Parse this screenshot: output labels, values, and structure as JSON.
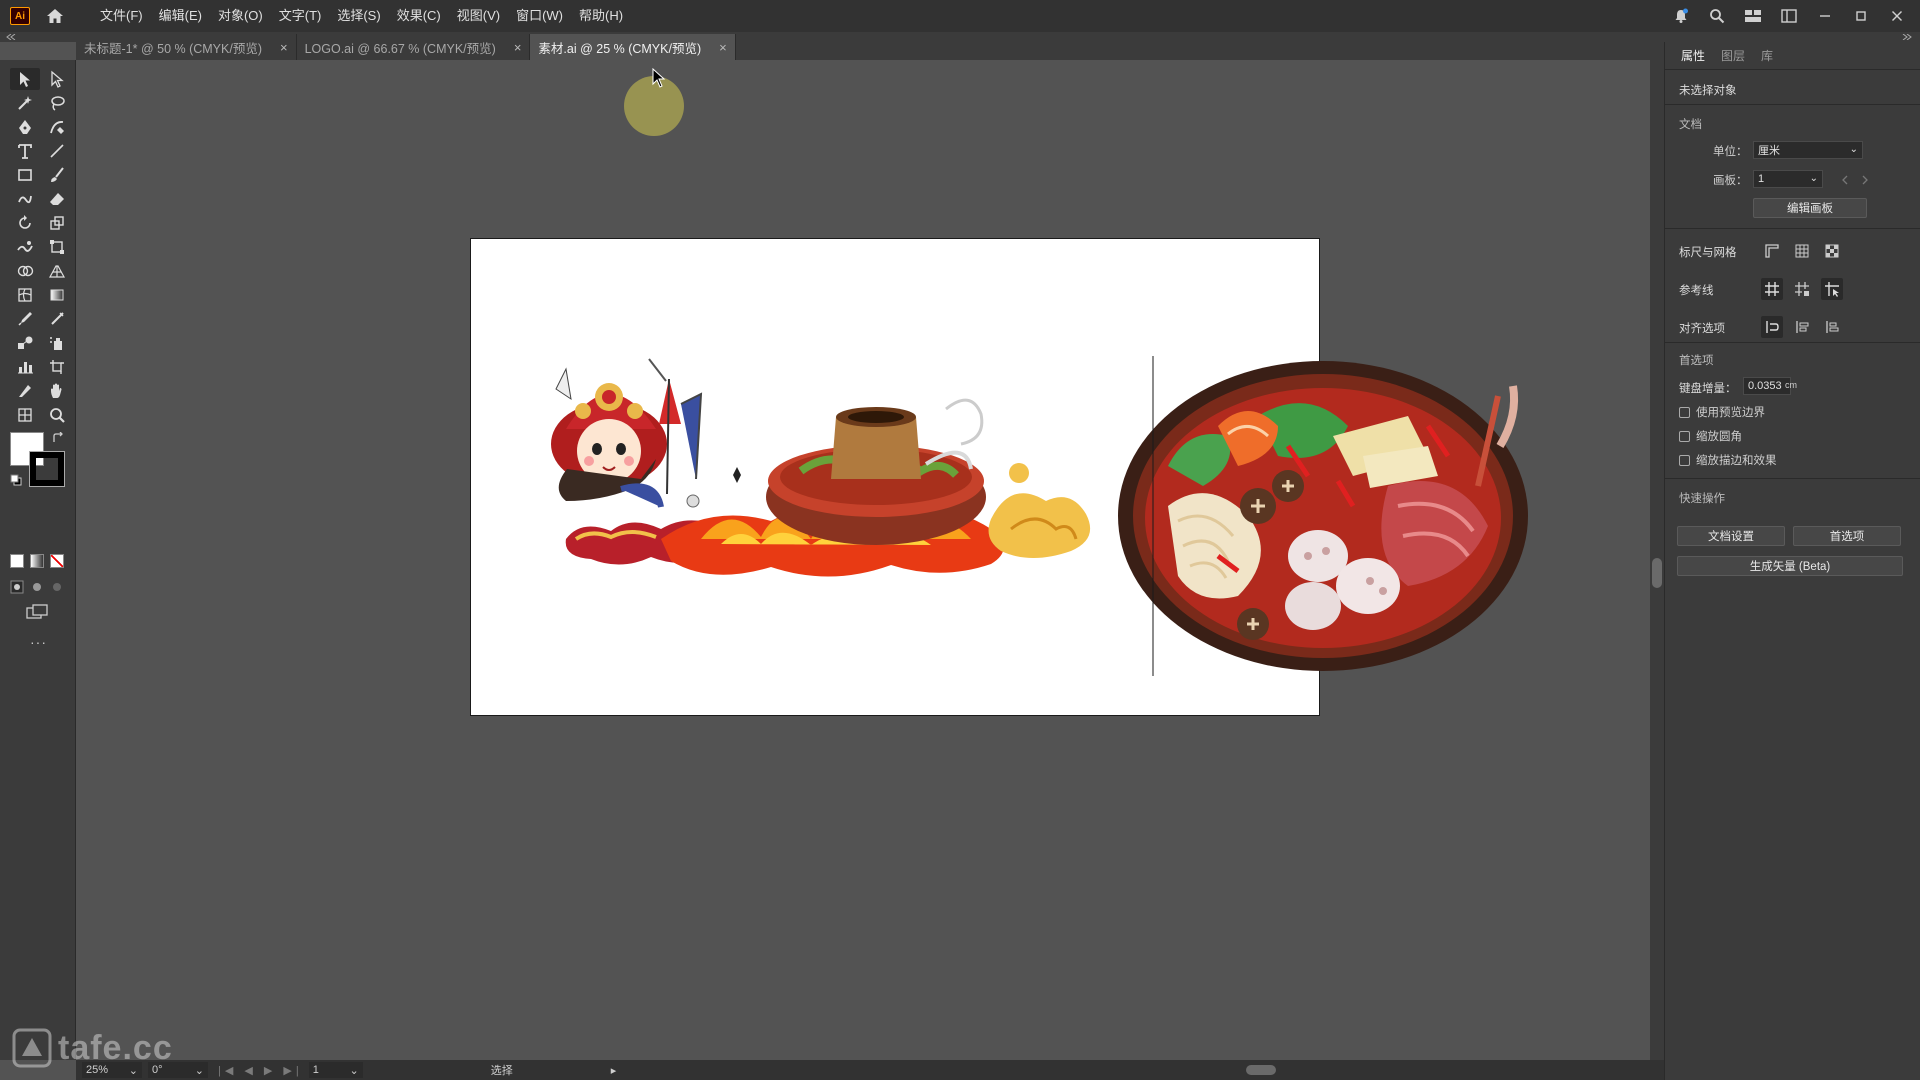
{
  "app": {
    "logo": "Ai",
    "menus": [
      "文件(F)",
      "编辑(E)",
      "对象(O)",
      "文字(T)",
      "选择(S)",
      "效果(C)",
      "视图(V)",
      "窗口(W)",
      "帮助(H)"
    ]
  },
  "tabs": [
    {
      "label": "未标题-1* @ 50 % (CMYK/预览)",
      "active": false
    },
    {
      "label": "LOGO.ai @ 66.67 % (CMYK/预览)",
      "active": false
    },
    {
      "label": "素材.ai @ 25 % (CMYK/预览)",
      "active": true
    }
  ],
  "tab_close": "×",
  "toolbar": {
    "more": "···",
    "icons": [
      "selection-tool-icon",
      "direct-selection-tool-icon",
      "magic-wand-icon",
      "lasso-icon",
      "pen-tool-icon",
      "curvature-tool-icon",
      "type-tool-icon",
      "line-tool-icon",
      "rectangle-tool-icon",
      "paintbrush-icon",
      "shaper-tool-icon",
      "eraser-icon",
      "rotate-tool-icon",
      "scale-tool-icon",
      "warp-tool-icon",
      "free-transform-icon",
      "shape-builder-icon",
      "perspective-grid-icon",
      "mesh-tool-icon",
      "gradient-tool-icon",
      "eyedropper-icon",
      "measure-icon",
      "blend-tool-icon",
      "symbol-sprayer-icon",
      "column-graph-icon",
      "artboard-tool-icon",
      "slice-tool-icon",
      "hand-tool-icon",
      "print-tiling-icon",
      "zoom-tool-icon"
    ]
  },
  "statusbar": {
    "zoom": "25%",
    "rotation": "0°",
    "artboard": "1",
    "tool": "选择",
    "nav": "|◀ ◀ ▶ ▶|"
  },
  "panel": {
    "tabs": [
      "属性",
      "图层",
      "库"
    ],
    "no_selection": "未选择对象",
    "document_header": "文档",
    "units_label": "单位：",
    "units_value": "厘米",
    "artboard_label": "画板：",
    "artboard_value": "1",
    "edit_artboard_button": "编辑画板",
    "rulers_grids_label": "标尺与网格",
    "guides_label": "参考线",
    "snap_options_label": "对齐选项",
    "preferences_header": "首选项",
    "keyboard_increment_label": "键盘增量：",
    "keyboard_increment_value": "0.0353",
    "keyboard_increment_unit": "cm",
    "checkboxes": [
      "使用预览边界",
      "缩放圆角",
      "缩放描边和效果"
    ],
    "quick_actions_header": "快速操作",
    "doc_setup_button": "文档设置",
    "preferences_button": "首选项",
    "generate_vectors_button": "生成矢量 (Beta)"
  },
  "watermark": "tafe.cc"
}
